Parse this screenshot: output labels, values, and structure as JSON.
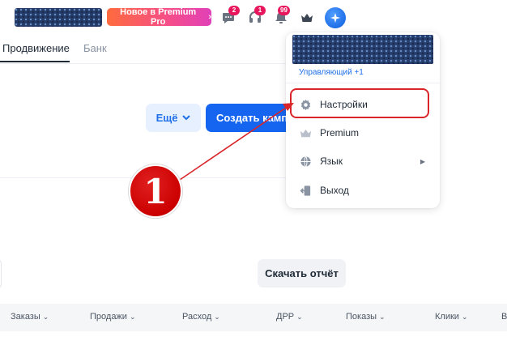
{
  "header": {
    "promo_label": "Новое в Premium Pro",
    "promo_chevron": "›",
    "chat_badge": "2",
    "support_badge": "1",
    "notifications_badge": "99",
    "icons": [
      "chat-icon",
      "support-headset-icon",
      "bell-icon",
      "crown-icon",
      "sparkle-icon"
    ]
  },
  "tabs": [
    {
      "label": "Продвижение",
      "active": true
    },
    {
      "label": "Банк",
      "active": false
    }
  ],
  "actions": {
    "more_label": "Ещё",
    "create_label": "Создать кампанию",
    "report_label": "Скачать отчёт"
  },
  "table": {
    "columns": [
      "Заказы",
      "Продажи",
      "Расход",
      "ДРР",
      "Показы",
      "Клики",
      "В"
    ]
  },
  "dropdown": {
    "managing_label": "Управляющий +1",
    "items": [
      {
        "label": "Настройки",
        "icon": "gear-icon"
      },
      {
        "label": "Premium",
        "icon": "crown-icon"
      },
      {
        "label": "Язык",
        "icon": "globe-icon",
        "submenu_arrow": "▶"
      },
      {
        "label": "Выход",
        "icon": "logout-icon"
      }
    ]
  },
  "annotation": {
    "step_number": "1",
    "color": "#d9252a"
  },
  "colors": {
    "accent": "#1565f0",
    "badge": "#e8175d"
  }
}
